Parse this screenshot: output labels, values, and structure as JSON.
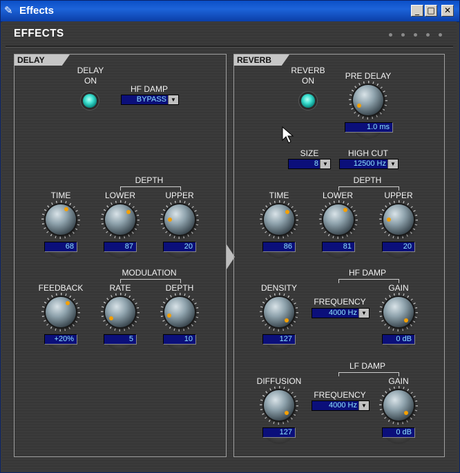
{
  "window": {
    "title": "Effects",
    "buttons": {
      "minimize": "_",
      "maximize": "□",
      "close": "✕"
    }
  },
  "header": {
    "title": "EFFECTS"
  },
  "delay": {
    "tab": "DELAY",
    "delay_on_label": "DELAY\nON",
    "hf_damp": {
      "label": "HF DAMP",
      "value": "BYPASS"
    },
    "depth_group": "DEPTH",
    "modulation_group": "MODULATION",
    "knobs": {
      "time": {
        "label": "TIME",
        "value": "68"
      },
      "lower": {
        "label": "LOWER",
        "value": "87"
      },
      "upper": {
        "label": "UPPER",
        "value": "20"
      },
      "feedback": {
        "label": "FEEDBACK",
        "value": "+20%"
      },
      "rate": {
        "label": "RATE",
        "value": "5"
      },
      "mod_depth": {
        "label": "DEPTH",
        "value": "10"
      }
    }
  },
  "reverb": {
    "tab": "REVERB",
    "reverb_on_label": "REVERB\nON",
    "pre_delay": {
      "label": "PRE DELAY",
      "value": "1.0 ms"
    },
    "size": {
      "label": "SIZE",
      "value": "8"
    },
    "high_cut": {
      "label": "HIGH CUT",
      "value": "12500 Hz"
    },
    "depth_group": "DEPTH",
    "hf_damp_group": "HF DAMP",
    "lf_damp_group": "LF DAMP",
    "knobs": {
      "time": {
        "label": "TIME",
        "value": "86"
      },
      "lower": {
        "label": "LOWER",
        "value": "81"
      },
      "upper": {
        "label": "UPPER",
        "value": "20"
      },
      "density": {
        "label": "DENSITY",
        "value": "127"
      },
      "hf_gain": {
        "label": "GAIN",
        "value": "0 dB"
      },
      "diffusion": {
        "label": "DIFFUSION",
        "value": "127"
      },
      "lf_gain": {
        "label": "GAIN",
        "value": "0 dB"
      }
    },
    "hf_frequency": {
      "label": "FREQUENCY",
      "value": "4000 Hz"
    },
    "lf_frequency": {
      "label": "FREQUENCY",
      "value": "4000 Hz"
    }
  }
}
